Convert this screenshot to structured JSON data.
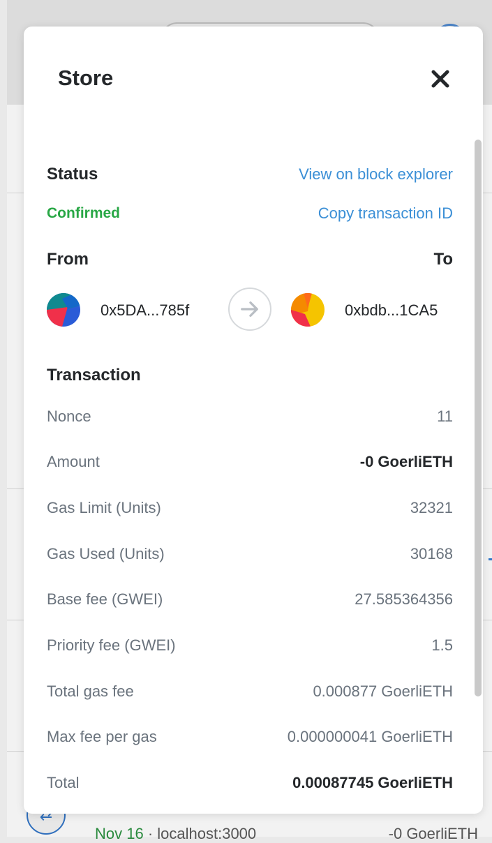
{
  "background": {
    "row_date": "Nov 16",
    "row_origin": " · localhost:3000",
    "row_amount": "-0 GoerliETH",
    "row_icon": "swap-arrows-icon"
  },
  "modal": {
    "title": "Store",
    "close_icon": "close-icon"
  },
  "status": {
    "label": "Status",
    "value": "Confirmed",
    "value_color": "#28a745",
    "view_explorer": "View on block explorer",
    "copy_id": "Copy transaction ID",
    "link_color": "#3b8fd6"
  },
  "from_to": {
    "from_label": "From",
    "to_label": "To",
    "from_address": "0x5DA...785f",
    "to_address": "0xbdb...1CA5",
    "arrow_icon": "arrow-right-icon"
  },
  "transaction": {
    "label": "Transaction",
    "rows": [
      {
        "label": "Nonce",
        "value": "11"
      },
      {
        "label": "Amount",
        "value": "-0 GoerliETH"
      },
      {
        "label": "Gas Limit (Units)",
        "value": "32321"
      },
      {
        "label": "Gas Used (Units)",
        "value": "30168"
      },
      {
        "label": "Base fee (GWEI)",
        "value": "27.585364356"
      },
      {
        "label": "Priority fee (GWEI)",
        "value": "1.5"
      },
      {
        "label": "Total gas fee",
        "value": "0.000877 GoerliETH"
      },
      {
        "label": "Max fee per gas",
        "value": "0.000000041 GoerliETH"
      },
      {
        "label": "Total",
        "value": "0.00087745 GoerliETH"
      }
    ]
  }
}
